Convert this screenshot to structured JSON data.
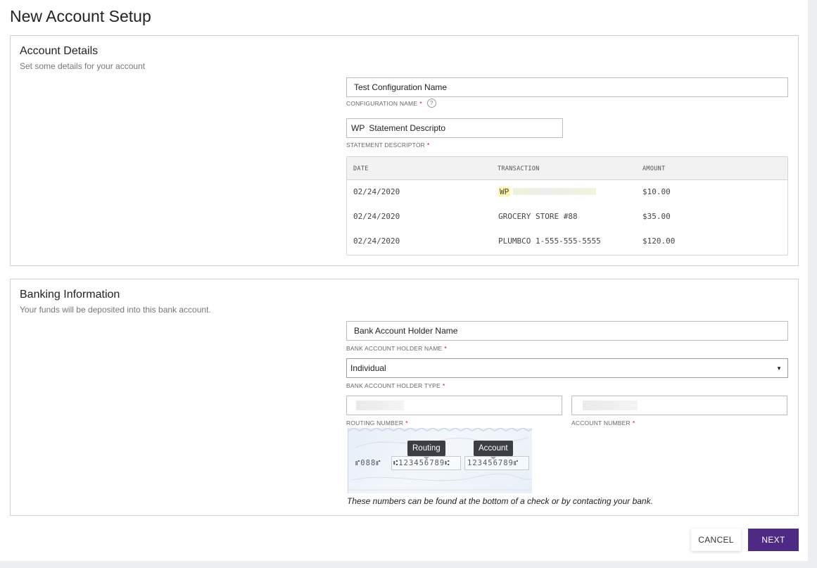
{
  "page": {
    "title": "New Account Setup"
  },
  "account_details": {
    "title": "Account Details",
    "subtitle": "Set some details for your account",
    "configuration_name": {
      "value": "Test Configuration Name",
      "label": "CONFIGURATION NAME",
      "required": "*",
      "help_icon": "?"
    },
    "statement_descriptor": {
      "prefix": "WP",
      "value": "Statement Descripto",
      "label": "STATEMENT DESCRIPTOR",
      "required": "*"
    },
    "preview_table": {
      "headers": {
        "date": "DATE",
        "transaction": "TRANSACTION",
        "amount": "AMOUNT"
      },
      "rows": [
        {
          "date": "02/24/2020",
          "transaction": "WP",
          "amount": "$10.00"
        },
        {
          "date": "02/24/2020",
          "transaction": "GROCERY STORE #88",
          "amount": "$35.00"
        },
        {
          "date": "02/24/2020",
          "transaction": "PLUMBCO 1-555-555-5555",
          "amount": "$120.00"
        }
      ]
    }
  },
  "banking_information": {
    "title": "Banking Information",
    "subtitle": "Your funds will be deposited into this bank account.",
    "holder_name": {
      "value": "Bank Account Holder Name",
      "label": "BANK ACCOUNT HOLDER NAME",
      "required": "*"
    },
    "holder_type": {
      "value": "Individual",
      "label": "BANK ACCOUNT HOLDER TYPE",
      "required": "*",
      "caret": "▼"
    },
    "routing_number": {
      "label": "ROUTING NUMBER",
      "required": "*"
    },
    "account_number": {
      "label": "ACCOUNT NUMBER",
      "required": "*"
    },
    "check_illustration": {
      "routing_tip": "Routing",
      "account_tip": "Account",
      "micr_check": "⑈088⑈",
      "micr_routing": "⑆123456789⑆",
      "micr_account": "123456789⑈"
    },
    "note": "These numbers can be found at the bottom of a check or by contacting your bank."
  },
  "actions": {
    "cancel_label": "CANCEL",
    "next_label": "NEXT"
  },
  "colors": {
    "primary": "#4e2a84",
    "required": "#d0021b",
    "highlight": "#fff6a8"
  }
}
